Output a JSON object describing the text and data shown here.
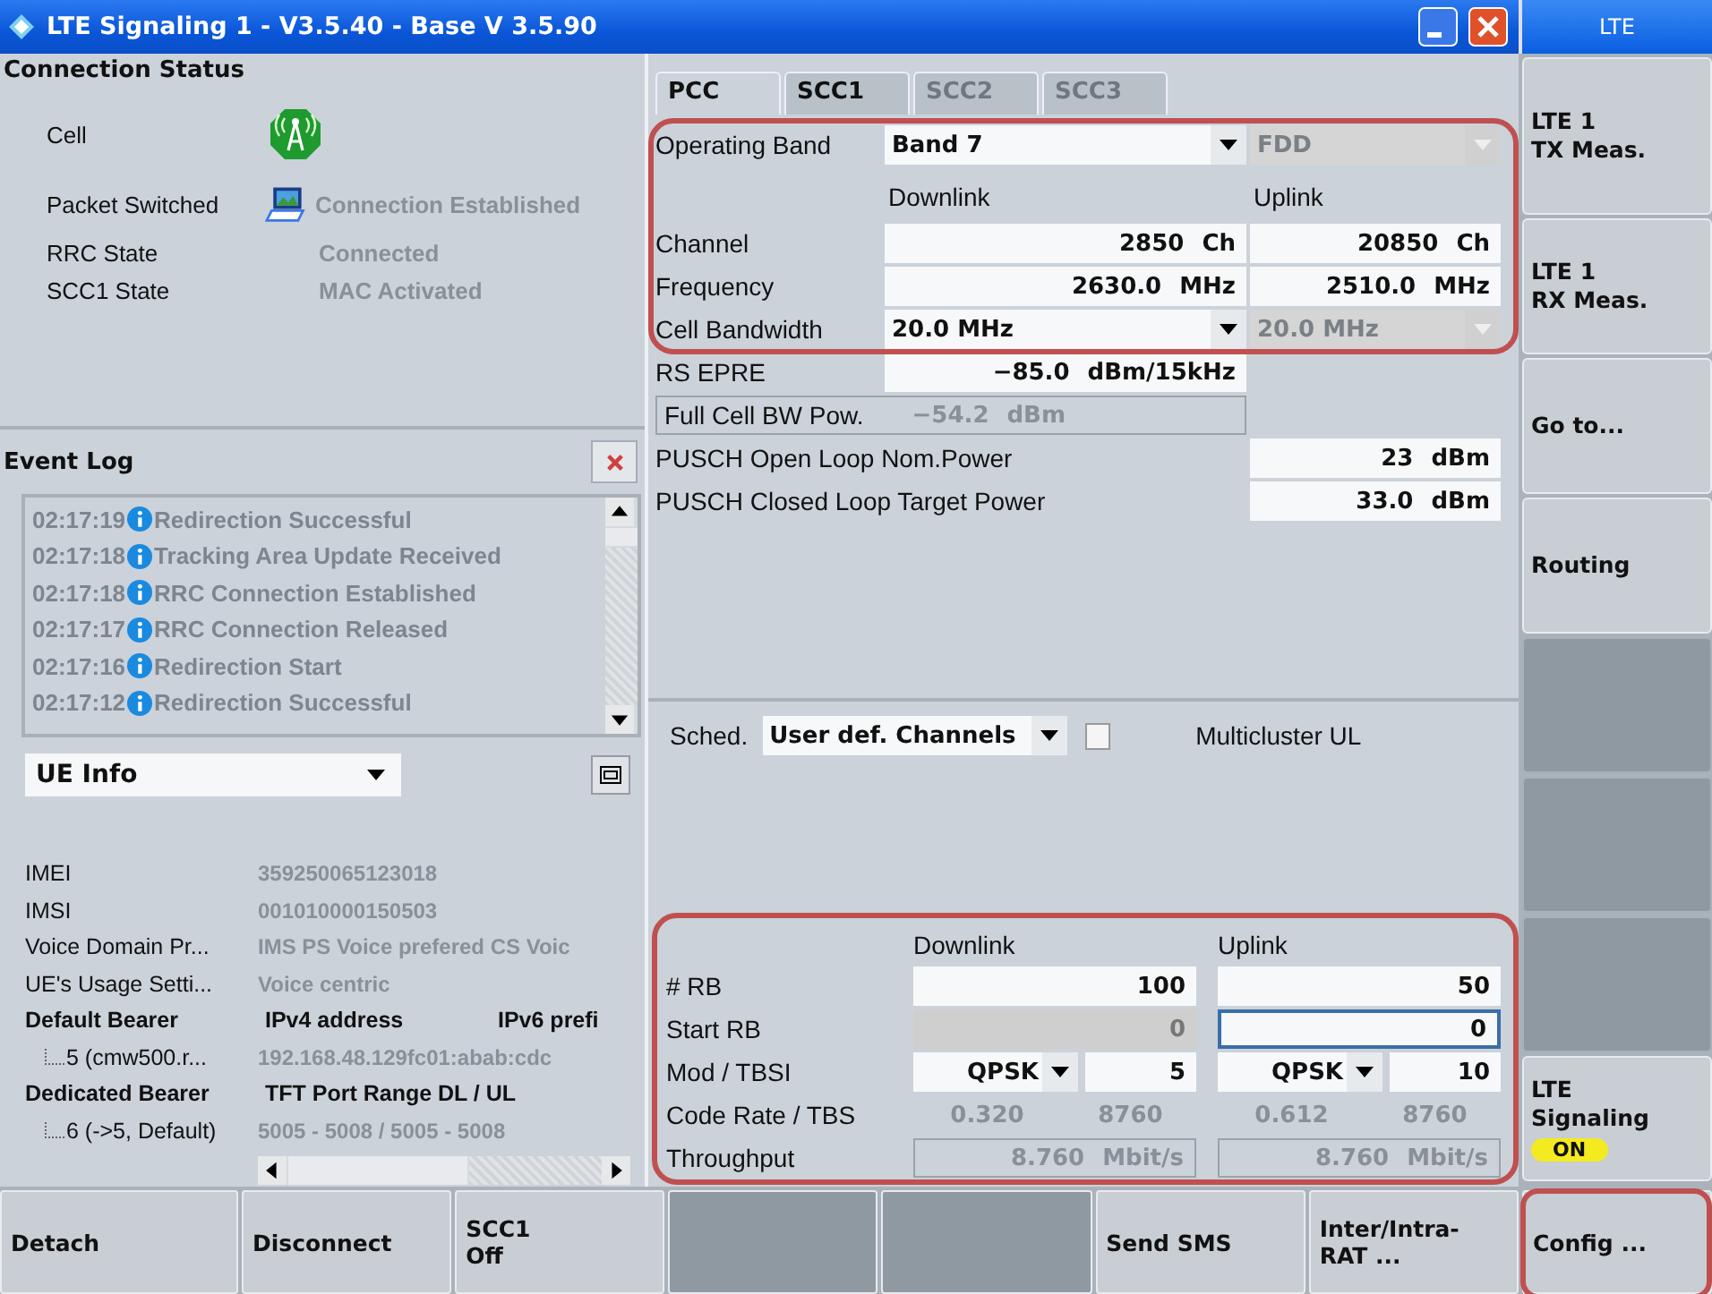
{
  "window": {
    "title": "LTE Signaling 1 - V3.5.40 - Base V 3.5.90"
  },
  "connection_status": {
    "title": "Connection Status",
    "rows": [
      {
        "kind": "cell",
        "label": "Cell"
      },
      {
        "kind": "packet",
        "label": "Packet Switched",
        "value": "Connection Established"
      },
      {
        "kind": "text",
        "label": "RRC State",
        "value": "Connected"
      },
      {
        "kind": "text",
        "label": "SCC1 State",
        "value": "MAC Activated"
      }
    ]
  },
  "event_log": {
    "title": "Event Log",
    "entries": [
      {
        "time": "02:17:19",
        "text": "Redirection Successful"
      },
      {
        "time": "02:17:18",
        "text": "Tracking Area Update Received"
      },
      {
        "time": "02:17:18",
        "text": "RRC Connection Established"
      },
      {
        "time": "02:17:17",
        "text": "RRC Connection Released"
      },
      {
        "time": "02:17:16",
        "text": "Redirection Start"
      },
      {
        "time": "02:17:12",
        "text": "Redirection Successful"
      }
    ]
  },
  "ue_info": {
    "selector": "UE Info",
    "rows": [
      {
        "kind": "pair",
        "label": "IMEI",
        "value": "359250065123018"
      },
      {
        "kind": "pair",
        "label": "IMSI",
        "value": "001010000150503"
      },
      {
        "kind": "pair",
        "label": "Voice Domain Pr...",
        "value": "IMS PS Voice prefered CS Voic"
      },
      {
        "kind": "pair",
        "label": "UE's Usage Setti...",
        "value": "Voice centric"
      },
      {
        "kind": "group",
        "cells": [
          "Default Bearer",
          "IPv4 address",
          "IPv6 prefi"
        ]
      },
      {
        "kind": "child",
        "label": "5 (cmw500.r...",
        "value": "192.168.48.129fc01:abab:cdc"
      },
      {
        "kind": "group",
        "cells": [
          "Dedicated Bearer",
          "TFT Port Range DL / UL"
        ]
      },
      {
        "kind": "child",
        "label": "6 (->5, Default)",
        "value": "5005  -  5008   / 5005  - 5008"
      }
    ]
  },
  "tabs": [
    {
      "label": "PCC",
      "selected": true,
      "disabled": false
    },
    {
      "label": "SCC1",
      "selected": false,
      "disabled": false
    },
    {
      "label": "SCC2",
      "selected": false,
      "disabled": true
    },
    {
      "label": "SCC3",
      "selected": false,
      "disabled": true
    }
  ],
  "carrier": {
    "highlighted": true,
    "rows": [
      {
        "kind": "dropdown",
        "label": "Operating Band",
        "downlink": {
          "value": "Band 7",
          "disabled": false
        },
        "uplink": {
          "value": "FDD",
          "disabled": true
        }
      },
      {
        "kind": "header",
        "downlink": "Downlink",
        "uplink": "Uplink"
      },
      {
        "kind": "value",
        "label": "Channel",
        "downlink": {
          "value": "2850",
          "unit": "Ch"
        },
        "uplink": {
          "value": "20850",
          "unit": "Ch"
        }
      },
      {
        "kind": "value",
        "label": "Frequency",
        "downlink": {
          "value": "2630.0",
          "unit": "MHz"
        },
        "uplink": {
          "value": "2510.0",
          "unit": "MHz"
        }
      },
      {
        "kind": "dropdown",
        "label": "Cell Bandwidth",
        "downlink": {
          "value": "20.0 MHz",
          "disabled": false
        },
        "uplink": {
          "value": "20.0 MHz",
          "disabled": true
        }
      }
    ]
  },
  "power": [
    {
      "kind": "downlink_field",
      "label": "RS EPRE",
      "value": "−85.0",
      "unit": "dBm/15kHz"
    },
    {
      "kind": "readout",
      "label": "Full Cell BW Pow.",
      "value": "−54.2",
      "unit": "dBm"
    },
    {
      "kind": "uplink_field",
      "label": "PUSCH Open Loop Nom.Power",
      "value": "23",
      "unit": "dBm"
    },
    {
      "kind": "uplink_field",
      "label": "PUSCH Closed Loop Target Power",
      "value": "33.0",
      "unit": "dBm"
    }
  ],
  "scheduling": {
    "label": "Sched.",
    "value": "User def. Channels",
    "multicluster": {
      "label": "Multicluster UL",
      "checked": false
    }
  },
  "resource_blocks": {
    "highlighted": true,
    "headers": [
      "Downlink",
      "Uplink"
    ],
    "rows": [
      {
        "kind": "number",
        "label": "# RB",
        "downlink": {
          "value": "100",
          "disabled": false,
          "focused": false
        },
        "uplink": {
          "value": "50",
          "disabled": false,
          "focused": false
        }
      },
      {
        "kind": "number",
        "label": "Start RB",
        "downlink": {
          "value": "0",
          "disabled": true,
          "focused": false
        },
        "uplink": {
          "value": "0",
          "disabled": false,
          "focused": true
        }
      },
      {
        "kind": "modulation",
        "label": "Mod / TBSI",
        "downlink": {
          "modulation": "QPSK",
          "tbsi": "5"
        },
        "uplink": {
          "modulation": "QPSK",
          "tbsi": "10"
        }
      },
      {
        "kind": "pair",
        "label": "Code Rate / TBS",
        "downlink": {
          "code_rate": "0.320",
          "tbs": "8760"
        },
        "uplink": {
          "code_rate": "0.612",
          "tbs": "8760"
        }
      },
      {
        "kind": "readout",
        "label": "Throughput",
        "downlink": {
          "value": "8.760",
          "unit": "Mbit/s"
        },
        "uplink": {
          "value": "8.760",
          "unit": "Mbit/s"
        }
      }
    ]
  },
  "side_header": "LTE",
  "side_keys": [
    {
      "kind": "key",
      "label": "LTE 1\nTX Meas."
    },
    {
      "kind": "key",
      "label": "LTE 1\nRX Meas."
    },
    {
      "kind": "key",
      "label": "Go to..."
    },
    {
      "kind": "key",
      "label": "Routing"
    },
    {
      "kind": "blank"
    },
    {
      "kind": "blank"
    },
    {
      "kind": "blank"
    },
    {
      "kind": "key",
      "label": "LTE\nSignaling",
      "badge": "ON"
    }
  ],
  "bottom_keys": [
    {
      "kind": "key",
      "label": "Detach"
    },
    {
      "kind": "key",
      "label": "Disconnect"
    },
    {
      "kind": "key",
      "label": "SCC1\nOff"
    },
    {
      "kind": "blank"
    },
    {
      "kind": "blank"
    },
    {
      "kind": "key",
      "label": "Send SMS"
    },
    {
      "kind": "key",
      "label": "Inter/Intra-\nRAT ..."
    }
  ],
  "corner_key": {
    "label": "Config ...",
    "highlighted": true
  }
}
